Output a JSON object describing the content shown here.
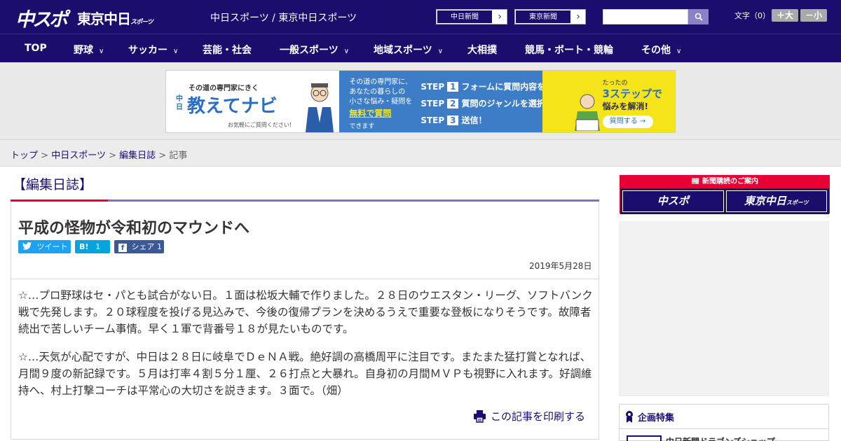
{
  "header": {
    "logo_chunichi": "中スポ",
    "logo_tokyo": "東京中日",
    "logo_tokyo_small": "スポーツ",
    "site_name": "中日スポーツ / 東京中日スポーツ",
    "paper_buttons": [
      "中日新聞",
      "東京新聞"
    ],
    "font_size_label": "文字（0）",
    "font_larger": "＋大",
    "font_smaller": "－小"
  },
  "nav": {
    "items": [
      {
        "label": "TOP"
      },
      {
        "label": "野球",
        "chevron": "∨"
      },
      {
        "label": "サッカー",
        "chevron": "∨"
      },
      {
        "label": "芸能・社会"
      },
      {
        "label": "一般スポーツ",
        "chevron": "∨"
      },
      {
        "label": "地域スポーツ",
        "chevron": "∨"
      },
      {
        "label": "大相撲"
      },
      {
        "label": "競馬・ボート・競輪"
      },
      {
        "label": "その他",
        "chevron": "∨"
      }
    ]
  },
  "banner": {
    "tagline": "その道の専門家にきく",
    "brand_prefix": "中日",
    "brand": "教えてナビ",
    "ask_note": "お気軽にご質問ください!",
    "desc": [
      "その道の専門家に、",
      "あなたの暮らしの",
      "小さな悩み・疑問を"
    ],
    "free": "無料で質問",
    "can": "できます",
    "steps": [
      {
        "label": "STEP",
        "num": "1",
        "text": "フォームに質問内容を入力"
      },
      {
        "label": "STEP",
        "num": "2",
        "text": "質問のジャンルを選択"
      },
      {
        "label": "STEP",
        "num": "3",
        "text": "送信！"
      }
    ],
    "right_top": "たったの",
    "right_main": "3ステップで",
    "right_sub": "悩みを解消!",
    "cta": "質問する"
  },
  "breadcrumb": {
    "items": [
      "トップ",
      "中日スポーツ",
      "編集日誌"
    ],
    "current": "記事",
    "separator": ">"
  },
  "article": {
    "category": "【編集日誌】",
    "title": "平成の怪物が令和初のマウンドへ",
    "share": {
      "tweet": "ツイート",
      "hatena": "B!",
      "hatena_count": "1",
      "facebook": "シェア",
      "facebook_count": "1"
    },
    "date": "2019年5月28日",
    "paragraphs": [
      "☆…プロ野球はセ・パとも試合がない日。１面は松坂大輔で作りました。２８日のウエスタン・リーグ、ソフトバンク戦で先発します。２０球程度を投げる見込みで、今後の復帰プランを決めるうえで重要な登板になりそうです。故障者続出で苦しいチーム事情。早く１軍で背番号１８が見たいものです。",
      "☆…天気が心配ですが、中日は２８日に岐阜でＤｅＮＡ戦。絶好調の高橋周平に注目です。またまた猛打賞となれば、月間９度の新記録です。５月は打率４割５分１厘、２６打点と大暴れ。自身初の月間ＭＶＰも視野に入れます。好調維持へ、村上打撃コーチは平常心の大切さを説きます。３面で。（畑）"
    ],
    "print": "この記事を印刷する"
  },
  "sidebar": {
    "promo_title": "新聞購読のご案内",
    "promo_chunichi": "中スポ",
    "promo_tokyo": "東京中日",
    "promo_tokyo_small": "スポーツ",
    "feature_title": "企画特集",
    "feature_item": "中日新聞ドラゴンズショップ"
  },
  "colors": {
    "navy": "#1b0d6e",
    "red": "#e60033",
    "lavender": "#7d70c7",
    "twitter": "#1da1f2",
    "hatena": "#00a4de",
    "facebook": "#3b5998"
  }
}
